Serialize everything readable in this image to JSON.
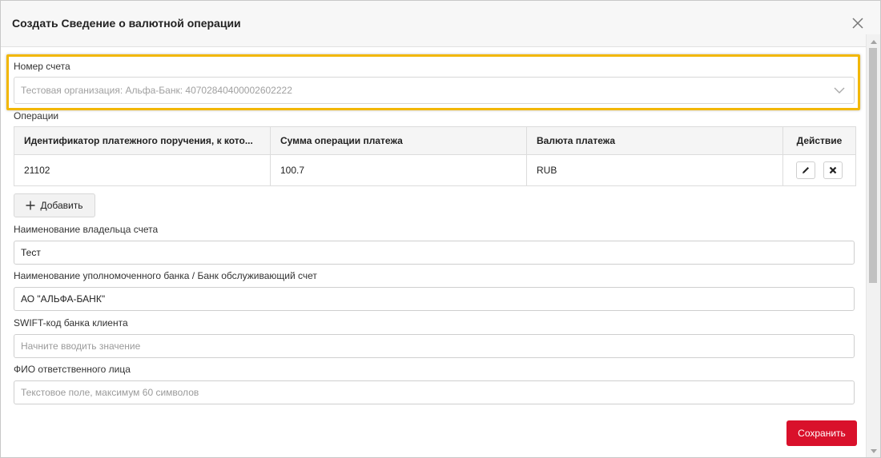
{
  "dialog": {
    "title": "Создать Сведение о валютной операции"
  },
  "account": {
    "label": "Номер счета",
    "value": "Тестовая организация: Альфа-Банк: 40702840400002602222"
  },
  "operations": {
    "label": "Операции",
    "columns": [
      "Идентификатор платежного поручения, к кото...",
      "Сумма операции платежа",
      "Валюта платежа",
      "Действие"
    ],
    "rows": [
      {
        "id": "21102",
        "amount": "100.7",
        "currency": "RUB"
      }
    ],
    "add_label": "Добавить"
  },
  "owner_name": {
    "label": "Наименование владельца счета",
    "value": "Тест"
  },
  "bank_name": {
    "label": "Наименование уполномоченного банка / Банк обслуживающий счет",
    "value": "АО \"АЛЬФА-БАНК\""
  },
  "swift": {
    "label": "SWIFT-код банка клиента",
    "placeholder": "Начните вводить значение"
  },
  "responsible": {
    "label": "ФИО ответственного лица",
    "placeholder": "Текстовое поле, максимум 60 символов"
  },
  "footer": {
    "save_label": "Сохранить"
  },
  "colors": {
    "accent": "#d9112b",
    "highlight": "#f2b705"
  }
}
